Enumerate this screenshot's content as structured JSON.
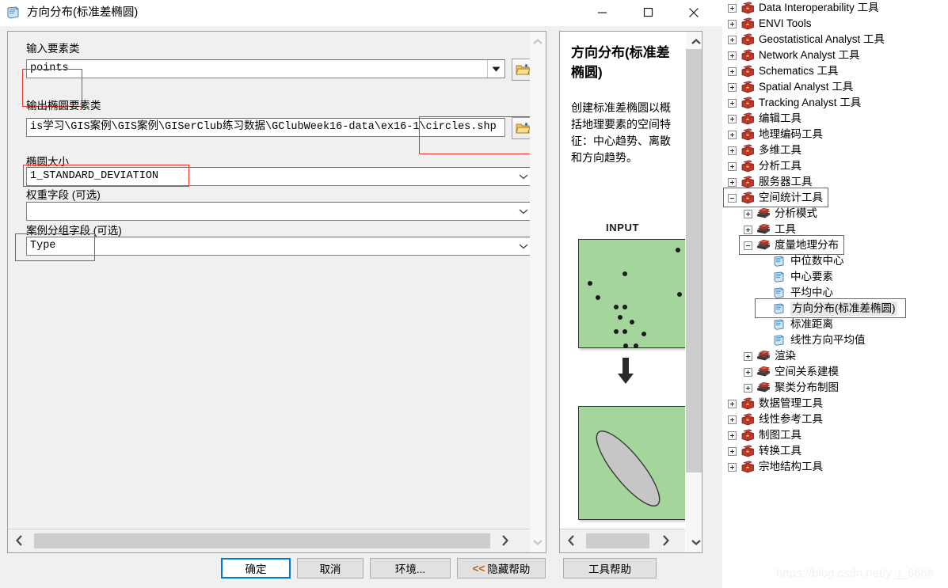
{
  "window": {
    "title": "方向分布(标准差椭圆)",
    "icon": "gp-tool-icon",
    "minimize_label": "−",
    "maximize_label": "□",
    "close_label": "×"
  },
  "form": {
    "fields": [
      {
        "label": "输入要素类",
        "value": "points",
        "placeholder": "",
        "type": "combobox",
        "highlighted": true,
        "browse": false
      },
      {
        "label": "输出椭圆要素类",
        "value": "is学习\\GIS案例\\GIS案例\\GISerClub练习数据\\GClubWeek16-data\\ex16-1\\circles.shp",
        "placeholder": "",
        "type": "text",
        "highlighted": true,
        "browse": true
      },
      {
        "label": "椭圆大小",
        "value": "1_STANDARD_DEVIATION",
        "placeholder": "",
        "type": "combobox",
        "highlighted": true,
        "browse": false
      },
      {
        "label": "权重字段 (可选)",
        "value": "",
        "placeholder": "",
        "type": "combobox",
        "highlighted": false,
        "browse": false
      },
      {
        "label": "案例分组字段 (可选)",
        "value": "Type",
        "placeholder": "",
        "type": "combobox",
        "highlighted": true,
        "browse": false
      }
    ]
  },
  "help": {
    "title": "方向分布(标准差椭圆)",
    "description": "创建标准差椭圆以概括地理要素的空间特征：中心趋势、离散和方向趋势。",
    "input_caption": "INPUT",
    "diagram_input_name": "point-scatter-diagram",
    "diagram_output_name": "standard-deviational-ellipse-diagram"
  },
  "buttons": {
    "ok": "确定",
    "cancel": "取消",
    "environments": "环境...",
    "hide_help_chevron": "<<",
    "hide_help": "隐藏帮助",
    "tool_help": "工具帮助"
  },
  "tree": {
    "items": [
      {
        "label": "Data Interoperability 工具",
        "indent": 0,
        "expander": "plus",
        "icon": "toolbox-icon",
        "highlighted": false,
        "selected": false
      },
      {
        "label": "ENVI Tools",
        "indent": 0,
        "expander": "plus",
        "icon": "toolbox-icon",
        "highlighted": false,
        "selected": false
      },
      {
        "label": "Geostatistical Analyst 工具",
        "indent": 0,
        "expander": "plus",
        "icon": "toolbox-icon",
        "highlighted": false,
        "selected": false
      },
      {
        "label": "Network Analyst 工具",
        "indent": 0,
        "expander": "plus",
        "icon": "toolbox-icon",
        "highlighted": false,
        "selected": false
      },
      {
        "label": "Schematics 工具",
        "indent": 0,
        "expander": "plus",
        "icon": "toolbox-icon",
        "highlighted": false,
        "selected": false
      },
      {
        "label": "Spatial Analyst 工具",
        "indent": 0,
        "expander": "plus",
        "icon": "toolbox-icon",
        "highlighted": false,
        "selected": false
      },
      {
        "label": "Tracking Analyst 工具",
        "indent": 0,
        "expander": "plus",
        "icon": "toolbox-icon",
        "highlighted": false,
        "selected": false
      },
      {
        "label": "编辑工具",
        "indent": 0,
        "expander": "plus",
        "icon": "toolbox-icon",
        "highlighted": false,
        "selected": false
      },
      {
        "label": "地理编码工具",
        "indent": 0,
        "expander": "plus",
        "icon": "toolbox-icon",
        "highlighted": false,
        "selected": false
      },
      {
        "label": "多维工具",
        "indent": 0,
        "expander": "plus",
        "icon": "toolbox-icon",
        "highlighted": false,
        "selected": false
      },
      {
        "label": "分析工具",
        "indent": 0,
        "expander": "plus",
        "icon": "toolbox-icon",
        "highlighted": false,
        "selected": false
      },
      {
        "label": "服务器工具",
        "indent": 0,
        "expander": "plus",
        "icon": "toolbox-icon",
        "highlighted": false,
        "selected": false
      },
      {
        "label": "空间统计工具",
        "indent": 0,
        "expander": "minus",
        "icon": "toolbox-icon",
        "highlighted": true,
        "selected": false
      },
      {
        "label": "分析模式",
        "indent": 1,
        "expander": "plus",
        "icon": "toolset-icon",
        "highlighted": false,
        "selected": false
      },
      {
        "label": "工具",
        "indent": 1,
        "expander": "plus",
        "icon": "toolset-icon",
        "highlighted": false,
        "selected": false
      },
      {
        "label": "度量地理分布",
        "indent": 1,
        "expander": "minus",
        "icon": "toolset-icon",
        "highlighted": true,
        "selected": false
      },
      {
        "label": "中位数中心",
        "indent": 2,
        "expander": "none",
        "icon": "tool-icon",
        "highlighted": false,
        "selected": false
      },
      {
        "label": "中心要素",
        "indent": 2,
        "expander": "none",
        "icon": "tool-icon",
        "highlighted": false,
        "selected": false
      },
      {
        "label": "平均中心",
        "indent": 2,
        "expander": "none",
        "icon": "tool-icon",
        "highlighted": false,
        "selected": false
      },
      {
        "label": "方向分布(标准差椭圆)",
        "indent": 2,
        "expander": "none",
        "icon": "tool-icon",
        "highlighted": true,
        "selected": true
      },
      {
        "label": "标准距离",
        "indent": 2,
        "expander": "none",
        "icon": "tool-icon",
        "highlighted": false,
        "selected": false
      },
      {
        "label": "线性方向平均值",
        "indent": 2,
        "expander": "none",
        "icon": "tool-icon",
        "highlighted": false,
        "selected": false
      },
      {
        "label": "渲染",
        "indent": 1,
        "expander": "plus",
        "icon": "toolset-icon",
        "highlighted": false,
        "selected": false
      },
      {
        "label": "空间关系建模",
        "indent": 1,
        "expander": "plus",
        "icon": "toolset-icon",
        "highlighted": false,
        "selected": false
      },
      {
        "label": "聚类分布制图",
        "indent": 1,
        "expander": "plus",
        "icon": "toolset-icon",
        "highlighted": false,
        "selected": false
      },
      {
        "label": "数据管理工具",
        "indent": 0,
        "expander": "plus",
        "icon": "toolbox-icon",
        "highlighted": false,
        "selected": false
      },
      {
        "label": "线性参考工具",
        "indent": 0,
        "expander": "plus",
        "icon": "toolbox-icon",
        "highlighted": false,
        "selected": false
      },
      {
        "label": "制图工具",
        "indent": 0,
        "expander": "plus",
        "icon": "toolbox-icon",
        "highlighted": false,
        "selected": false
      },
      {
        "label": "转换工具",
        "indent": 0,
        "expander": "plus",
        "icon": "toolbox-icon",
        "highlighted": false,
        "selected": false
      },
      {
        "label": "宗地结构工具",
        "indent": 0,
        "expander": "plus",
        "icon": "toolbox-icon",
        "highlighted": false,
        "selected": false
      }
    ]
  },
  "watermark": "https://blog.csdn.net/y_j_6666",
  "colors": {
    "accent": "#0078d7",
    "highlight_box": "#ea3323",
    "diagram_fill": "#a4d69c",
    "ellipse_fill": "#c6c6c6",
    "dialog_bg": "#f0f0f0",
    "chevron": "#b5651d"
  }
}
